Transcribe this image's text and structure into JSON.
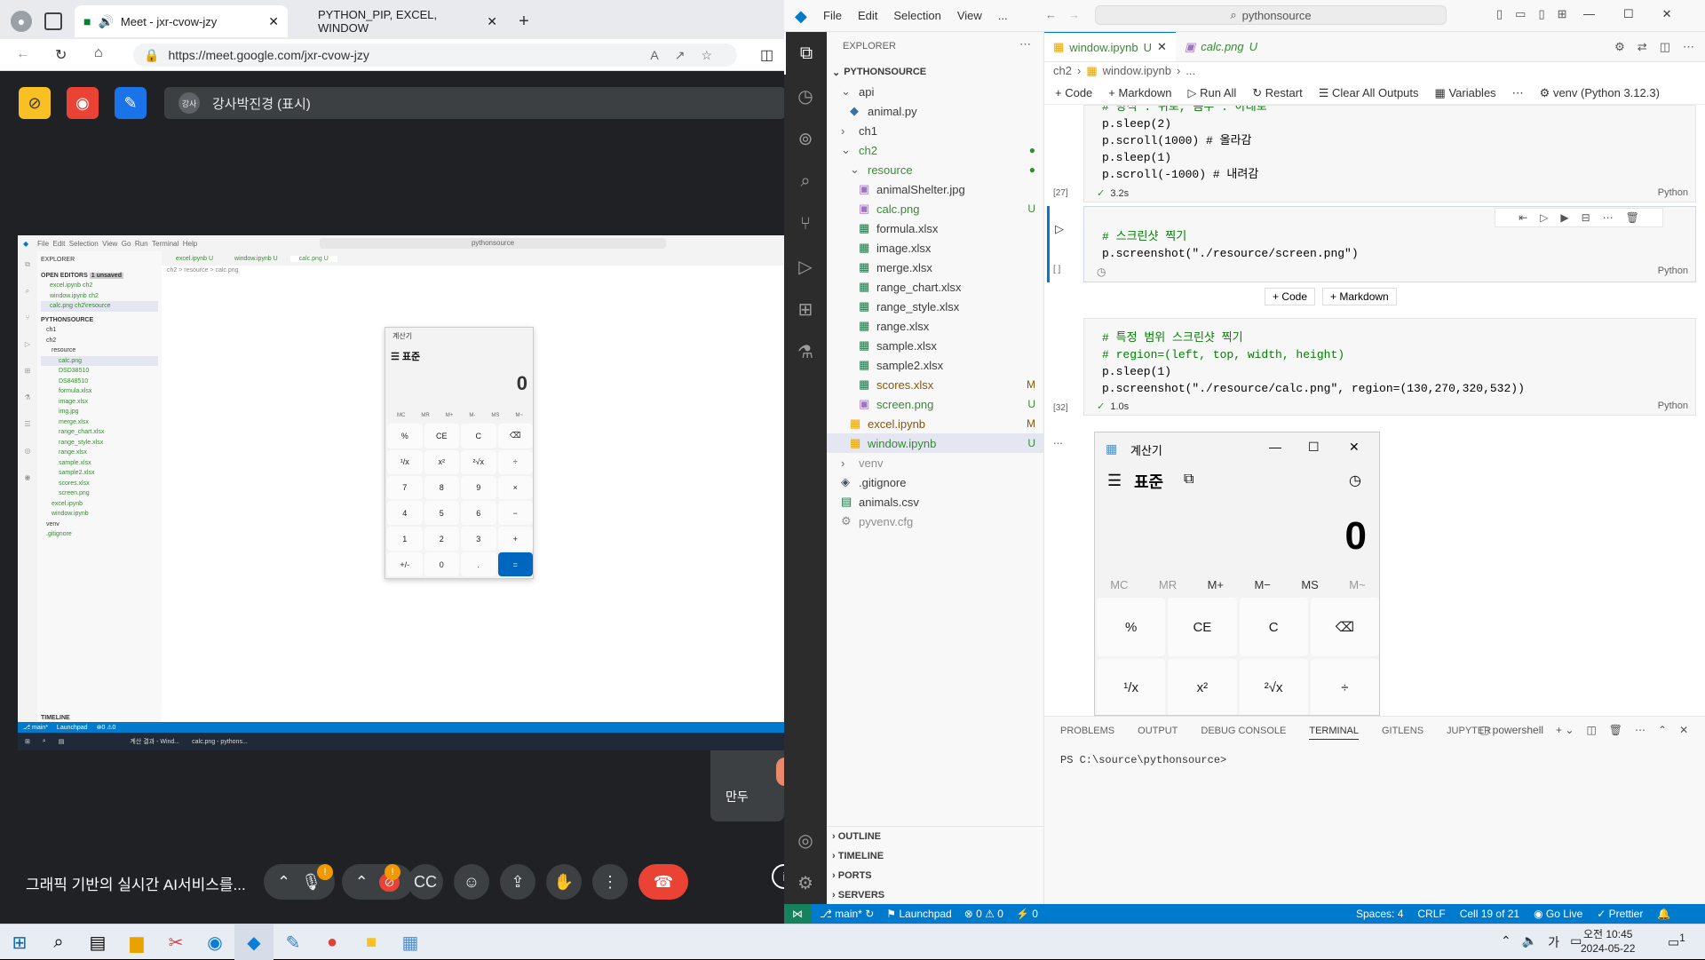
{
  "browser": {
    "tabs": [
      {
        "label": "Meet - jxr-cvow-jzy"
      },
      {
        "label": "PYTHON_PIP, EXCEL, WINDOW"
      }
    ],
    "url": "https://meet.google.com/jxr-cvow-jzy"
  },
  "meet": {
    "presenter": "강사박진경 (표시)",
    "presenter_initial": "강사",
    "tile_name": "만두",
    "meeting_title": "그래픽 기반의 실시간 AI서비스를...",
    "badge": "!"
  },
  "shared_screen": {
    "menu": [
      "File",
      "Edit",
      "Selection",
      "View",
      "Go",
      "Run",
      "Terminal",
      "Help"
    ],
    "search": "pythonsource",
    "tabs": [
      "excel.ipynb U",
      "window.ipynb U",
      "calc.png U"
    ],
    "breadcrumb": "ch2 > resource > calc.png",
    "explorer_title": "EXPLORER",
    "open_editors": "OPEN EDITORS",
    "unsaved": "1 unsaved",
    "open_files": [
      "excel.ipynb ch2",
      "window.ipynb ch2",
      "calc.png ch2\\resource"
    ],
    "root": "PYTHONSOURCE",
    "files": [
      "ch1",
      "ch2",
      "resource",
      "calc.png",
      "DSD38510",
      "DS848510",
      "formula.xlsx",
      "image.xlsx",
      "img.jpg",
      "merge.xlsx",
      "range_chart.xlsx",
      "range_style.xlsx",
      "range.xlsx",
      "sample.xlsx",
      "sample2.xlsx",
      "scores.xlsx",
      "screen.png",
      "excel.ipynb",
      "window.ipynb",
      "venv",
      ".gitignore"
    ],
    "timeline": "TIMELINE",
    "status_branch": "main*",
    "status_launchpad": "Launchpad",
    "task1": "계산 결과 - Wind...",
    "task2": "calc.png - pythons..."
  },
  "calculator_small": {
    "title": "계산기",
    "mode": "표준",
    "display": "0",
    "mem": [
      "MC",
      "MR",
      "M+",
      "M-",
      "MS",
      "M~"
    ],
    "keys": [
      "%",
      "CE",
      "C",
      "⌫",
      "¹/x",
      "x²",
      "²√x",
      "÷",
      "7",
      "8",
      "9",
      "×",
      "4",
      "5",
      "6",
      "−",
      "1",
      "2",
      "3",
      "+",
      "+/-",
      "0",
      ".",
      "="
    ]
  },
  "vscode": {
    "menu": [
      "File",
      "Edit",
      "Selection",
      "View",
      "..."
    ],
    "search": "pythonsource",
    "explorer_title": "EXPLORER",
    "root": "PYTHONSOURCE",
    "tree": [
      {
        "label": "api",
        "indent": 1,
        "kind": "folder-open",
        "status": ""
      },
      {
        "label": "animal.py",
        "indent": 2,
        "kind": "py",
        "status": ""
      },
      {
        "label": "ch1",
        "indent": 1,
        "kind": "folder",
        "status": ""
      },
      {
        "label": "ch2",
        "indent": 1,
        "kind": "folder-open",
        "status": "●"
      },
      {
        "label": "resource",
        "indent": 2,
        "kind": "folder-open",
        "status": "●"
      },
      {
        "label": "animalShelter.jpg",
        "indent": 3,
        "kind": "img",
        "status": ""
      },
      {
        "label": "calc.png",
        "indent": 3,
        "kind": "img",
        "status": "U"
      },
      {
        "label": "formula.xlsx",
        "indent": 3,
        "kind": "xls",
        "status": ""
      },
      {
        "label": "image.xlsx",
        "indent": 3,
        "kind": "xls",
        "status": ""
      },
      {
        "label": "merge.xlsx",
        "indent": 3,
        "kind": "xls",
        "status": ""
      },
      {
        "label": "range_chart.xlsx",
        "indent": 3,
        "kind": "xls",
        "status": ""
      },
      {
        "label": "range_style.xlsx",
        "indent": 3,
        "kind": "xls",
        "status": ""
      },
      {
        "label": "range.xlsx",
        "indent": 3,
        "kind": "xls",
        "status": ""
      },
      {
        "label": "sample.xlsx",
        "indent": 3,
        "kind": "xls",
        "status": ""
      },
      {
        "label": "sample2.xlsx",
        "indent": 3,
        "kind": "xls",
        "status": ""
      },
      {
        "label": "scores.xlsx",
        "indent": 3,
        "kind": "xls",
        "status": "M"
      },
      {
        "label": "screen.png",
        "indent": 3,
        "kind": "img",
        "status": "U"
      },
      {
        "label": "excel.ipynb",
        "indent": 2,
        "kind": "nb",
        "status": "M"
      },
      {
        "label": "window.ipynb",
        "indent": 2,
        "kind": "nb",
        "status": "U"
      },
      {
        "label": "venv",
        "indent": 1,
        "kind": "folder",
        "status": ""
      },
      {
        "label": ".gitignore",
        "indent": 1,
        "kind": "git",
        "status": ""
      },
      {
        "label": "animals.csv",
        "indent": 1,
        "kind": "csv",
        "status": ""
      },
      {
        "label": "pyvenv.cfg",
        "indent": 1,
        "kind": "cfg",
        "status": ""
      }
    ],
    "outline_sections": [
      "OUTLINE",
      "TIMELINE",
      "PORTS",
      "SERVERS"
    ],
    "tabs": [
      {
        "label": "window.ipynb",
        "status": "U"
      },
      {
        "label": "calc.png",
        "status": "U"
      }
    ],
    "breadcrumb": [
      "ch2",
      "window.ipynb",
      "..."
    ],
    "toolbar": [
      "+ Code",
      "+ Markdown",
      "Run All",
      "Restart",
      "Clear All Outputs",
      "Variables",
      "venv (Python 3.12.3)"
    ],
    "cell1": {
      "lines": [
        "# 방식 : 위로, 음수 : 아래로",
        "p.sleep(2)",
        "p.scroll(1000) # 올라감",
        "p.sleep(1)",
        "p.scroll(-1000) # 내려감"
      ],
      "exec": "[27]",
      "time": "3.2s",
      "lang": "Python"
    },
    "cell2": {
      "lines": [
        "# 스크린샷 찍기",
        "p.screenshot(\"./resource/screen.png\")"
      ],
      "exec": "[ ]",
      "lang": "Python"
    },
    "add_code": "+ Code",
    "add_markdown": "+ Markdown",
    "cell3": {
      "lines": [
        "# 특정 범위 스크린샷 찍기",
        "# region=(left, top, width, height)",
        "p.sleep(1)",
        "p.screenshot(\"./resource/calc.png\", region=(130,270,320,532))"
      ],
      "exec": "[32]",
      "time": "1.0s",
      "lang": "Python"
    },
    "output_more": "...",
    "panel_tabs": [
      "PROBLEMS",
      "OUTPUT",
      "DEBUG CONSOLE",
      "TERMINAL",
      "GITLENS",
      "JUPYTER"
    ],
    "active_panel_tab": "TERMINAL",
    "shell": "powershell",
    "prompt": "PS C:\\source\\pythonsource>",
    "status": {
      "branch": "main*",
      "launchpad": "Launchpad",
      "errors": "0",
      "warnings": "0",
      "ports": "0",
      "spaces": "Spaces: 4",
      "eol": "CRLF",
      "cell": "Cell 19 of 21",
      "golive": "Go Live",
      "prettier": "Prettier"
    }
  },
  "calculator_large": {
    "title": "계산기",
    "mode": "표준",
    "display": "0",
    "mem": [
      "MC",
      "MR",
      "M+",
      "M−",
      "MS",
      "M~"
    ],
    "keys": [
      "%",
      "CE",
      "C",
      "⌫",
      "¹/x",
      "x²",
      "²√x",
      "÷"
    ]
  },
  "taskbar": {
    "time": "오전 10:45",
    "date": "2024-05-22",
    "ime": "가",
    "notif": "1"
  },
  "colors": {
    "vscode_status": "#007acc",
    "meet_bg": "#202124",
    "end_call": "#ea4335",
    "accent": "#0067c0"
  }
}
